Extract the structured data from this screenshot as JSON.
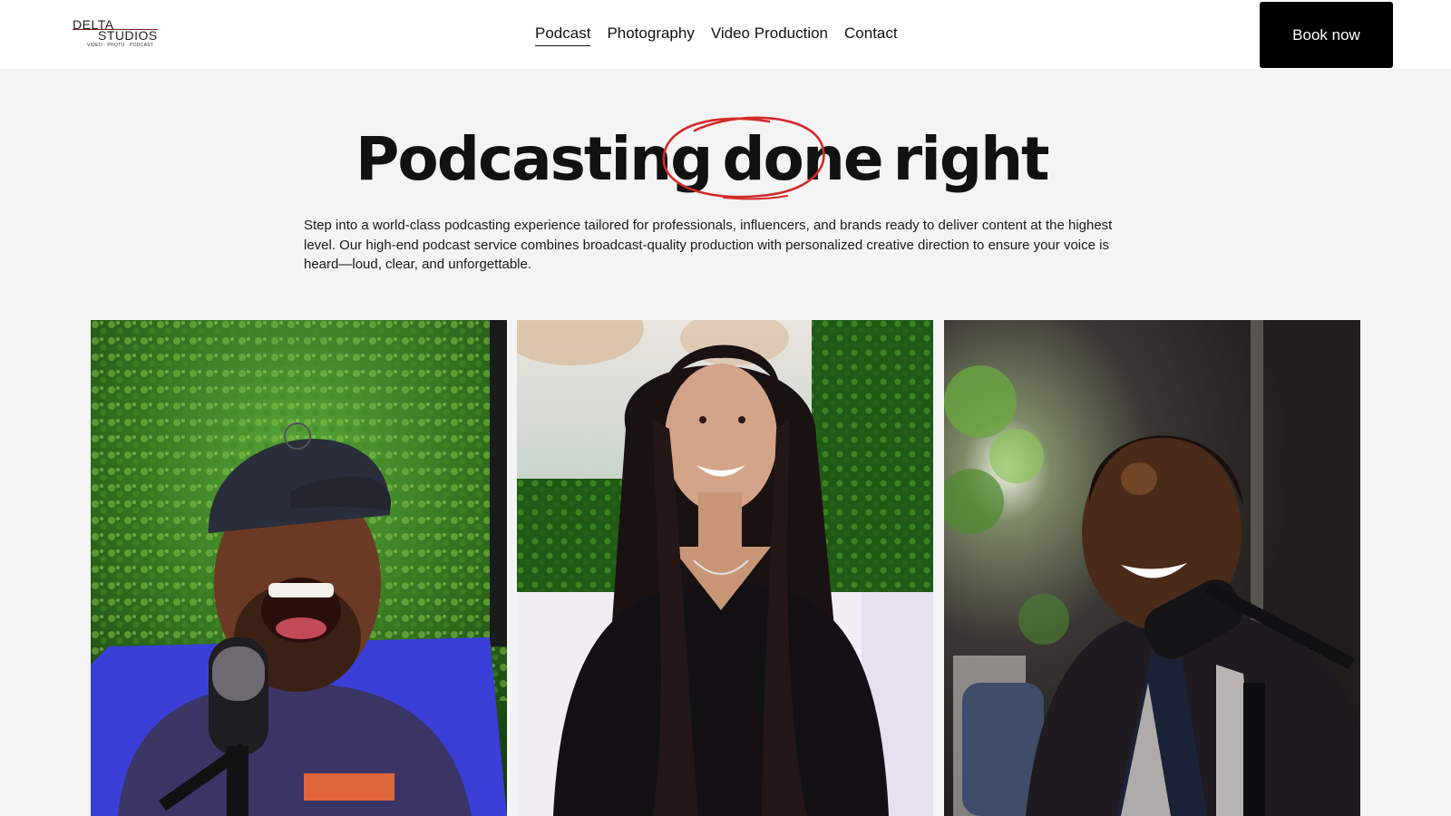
{
  "header": {
    "logo": {
      "line1": "DELTA",
      "line2": "STUDIOS",
      "tagline": "VIDEO · PHOTO · PODCAST"
    },
    "nav": [
      {
        "label": "Podcast",
        "active": true
      },
      {
        "label": "Photography",
        "active": false
      },
      {
        "label": "Video Production",
        "active": false
      },
      {
        "label": "Contact",
        "active": false
      }
    ],
    "cta_label": "Book now"
  },
  "hero": {
    "headline_part1": "Podcasting",
    "headline_part2": "done",
    "headline_part3": "right",
    "intro": "Step into a world-class podcasting experience tailored for professionals, influencers, and brands ready to deliver content at the highest level. Our high-end podcast service combines broadcast-quality production with personalized creative direction to ensure your voice is heard—loud, clear, and unforgettable."
  },
  "colors": {
    "accent_red": "#d42a2a",
    "button_bg": "#000000",
    "page_bg": "#f4f4f4"
  },
  "photos": [
    {
      "subject": "laughing-man-with-cap-photo"
    },
    {
      "subject": "smiling-woman-long-hair-photo"
    },
    {
      "subject": "smiling-man-with-microphone-photo"
    }
  ]
}
